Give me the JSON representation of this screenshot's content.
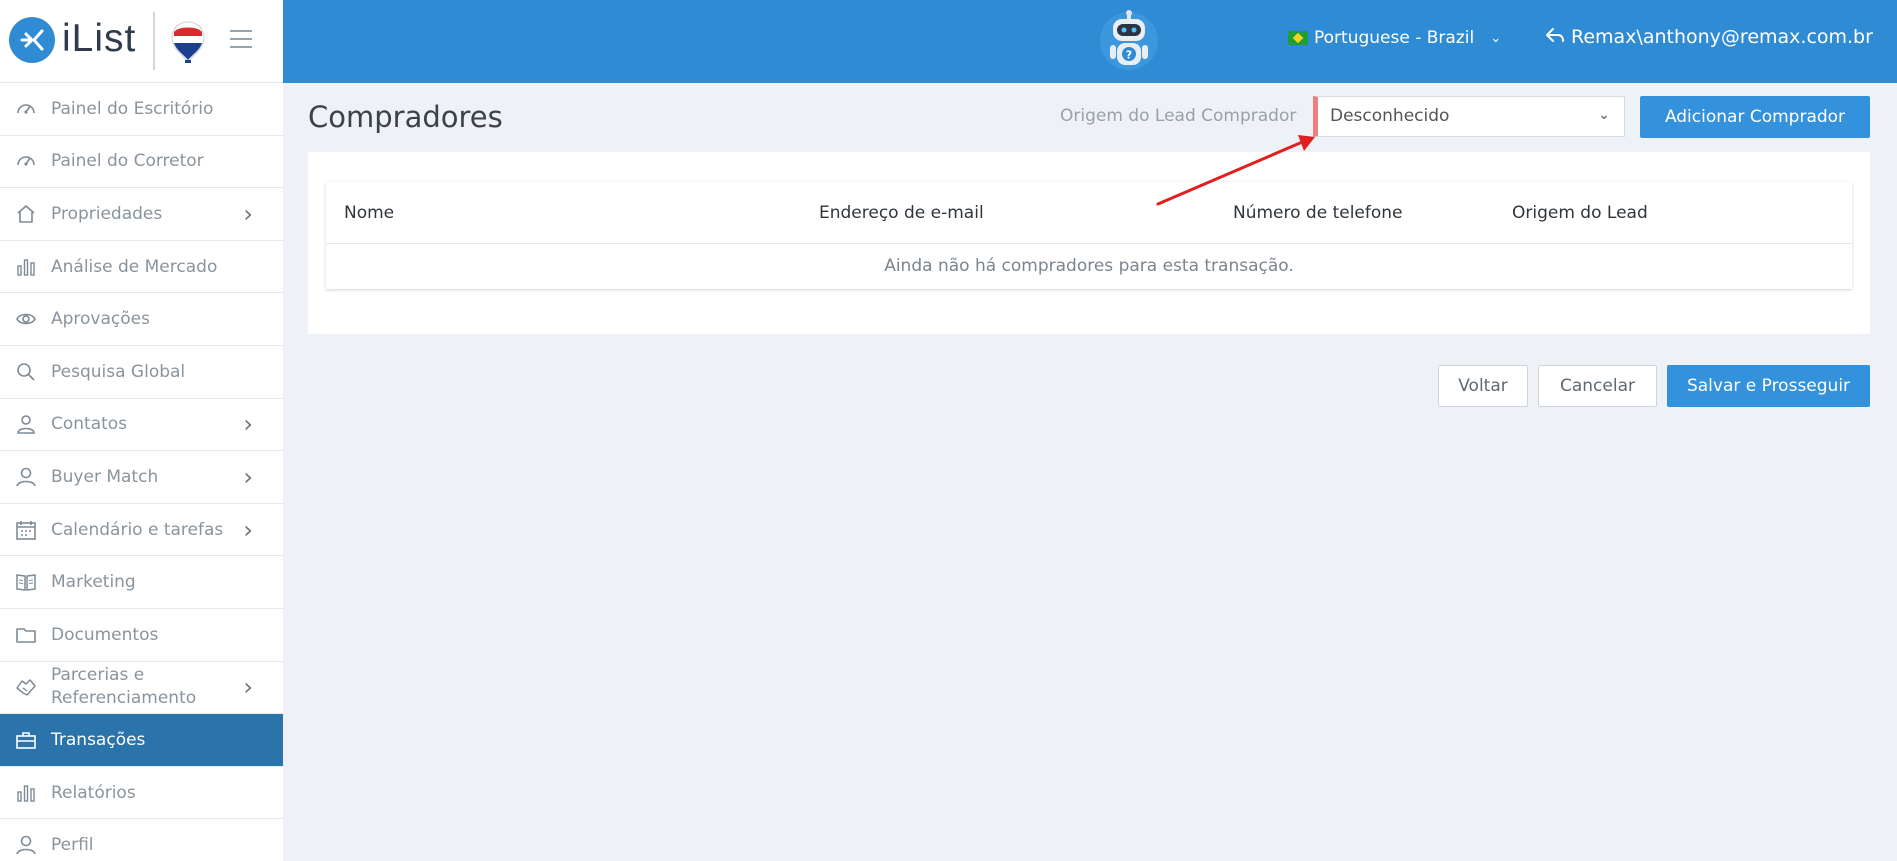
{
  "app": {
    "logo_text": "iList"
  },
  "header": {
    "language": "Portuguese - Brazil",
    "user": "Remax\\anthony@remax.com.br"
  },
  "sidebar": {
    "items": [
      {
        "label": "Painel do Escritório",
        "icon": "gauge-icon",
        "submenu": false,
        "active": false
      },
      {
        "label": "Painel do Corretor",
        "icon": "gauge-icon",
        "submenu": false,
        "active": false
      },
      {
        "label": "Propriedades",
        "icon": "home-icon",
        "submenu": true,
        "active": false
      },
      {
        "label": "Análise de Mercado",
        "icon": "bar-chart-icon",
        "submenu": false,
        "active": false
      },
      {
        "label": "Aprovações",
        "icon": "eye-icon",
        "submenu": false,
        "active": false
      },
      {
        "label": "Pesquisa Global",
        "icon": "search-icon",
        "submenu": false,
        "active": false
      },
      {
        "label": "Contatos",
        "icon": "contacts-icon",
        "submenu": true,
        "active": false
      },
      {
        "label": "Buyer Match",
        "icon": "user-icon",
        "submenu": true,
        "active": false
      },
      {
        "label": "Calendário e tarefas",
        "icon": "calendar-icon",
        "submenu": true,
        "active": false
      },
      {
        "label": "Marketing",
        "icon": "book-icon",
        "submenu": false,
        "active": false
      },
      {
        "label": "Documentos",
        "icon": "folder-icon",
        "submenu": false,
        "active": false
      },
      {
        "label": "Parcerias e Referenciamento",
        "icon": "handshake-icon",
        "submenu": true,
        "active": false
      },
      {
        "label": "Transações",
        "icon": "briefcase-icon",
        "submenu": false,
        "active": true
      },
      {
        "label": "Relatórios",
        "icon": "bar-chart-icon",
        "submenu": false,
        "active": false
      },
      {
        "label": "Perfil",
        "icon": "user-icon",
        "submenu": false,
        "active": false
      }
    ]
  },
  "main": {
    "title": "Compradores",
    "filter_label": "Origem do Lead Comprador",
    "filter_value": "Desconhecido",
    "add_button": "Adicionar Comprador",
    "table": {
      "columns": [
        "Nome",
        "Endereço de e-mail",
        "Número de telefone",
        "Origem do Lead"
      ],
      "empty_message": "Ainda não há compradores para esta transação."
    },
    "buttons": {
      "back": "Voltar",
      "cancel": "Cancelar",
      "save": "Salvar e Prosseguir"
    }
  },
  "colors": {
    "header_blue": "#2f8bd4",
    "active_nav": "#2b74ab",
    "primary_button": "#3491dc",
    "select_accent": "#ef7f7f",
    "annotation_arrow": "#e02020"
  }
}
